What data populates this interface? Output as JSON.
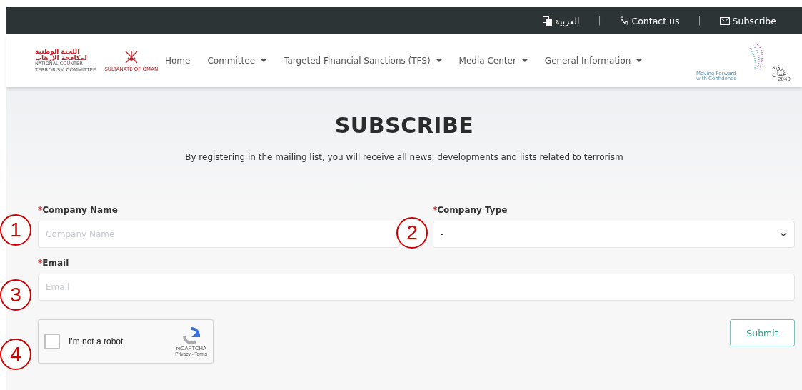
{
  "top_bar": {
    "language": "العربية",
    "contact": "Contact us",
    "subscribe": "Subscribe",
    "separators": [
      "|",
      "|"
    ]
  },
  "header": {
    "logo": {
      "arabic": "اللجنة الوطنية لمكافحة الإرهاب",
      "line_1": "NATIONAL COUNTER",
      "line_2": "TERRORISM COMMITTEE",
      "emblem_caption": "SULTANATE OF OMAN"
    },
    "nav": [
      {
        "label": "Home",
        "dropdown": false
      },
      {
        "label": "Committee",
        "dropdown": true
      },
      {
        "label": "Targeted Financial Sanctions (TFS)",
        "dropdown": true
      },
      {
        "label": "Media Center",
        "dropdown": true
      },
      {
        "label": "General Information",
        "dropdown": true
      }
    ],
    "vision_logo": {
      "arabic": "رؤية عُمان",
      "year": "2040",
      "tagline_line_1": "Moving Forward",
      "tagline_line_2": "with Confidence"
    }
  },
  "page": {
    "title": "SUBSCRIBE",
    "subtitle": "By registering in the mailing list, you will receive all news, developments and lists related to terrorism"
  },
  "form": {
    "company_name": {
      "label": "Company Name",
      "required_mark": "*",
      "placeholder": "Company Name"
    },
    "company_type": {
      "label": "Company Type",
      "required_mark": "*",
      "value": "-"
    },
    "email": {
      "label": "Email",
      "required_mark": "*",
      "placeholder": "Email"
    },
    "captcha": {
      "label": "I'm not a robot",
      "checked": false,
      "brand": "reCAPTCHA",
      "links": "Privacy - Terms"
    },
    "submit": "Submit"
  },
  "callouts": [
    "1",
    "2",
    "3",
    "4"
  ]
}
